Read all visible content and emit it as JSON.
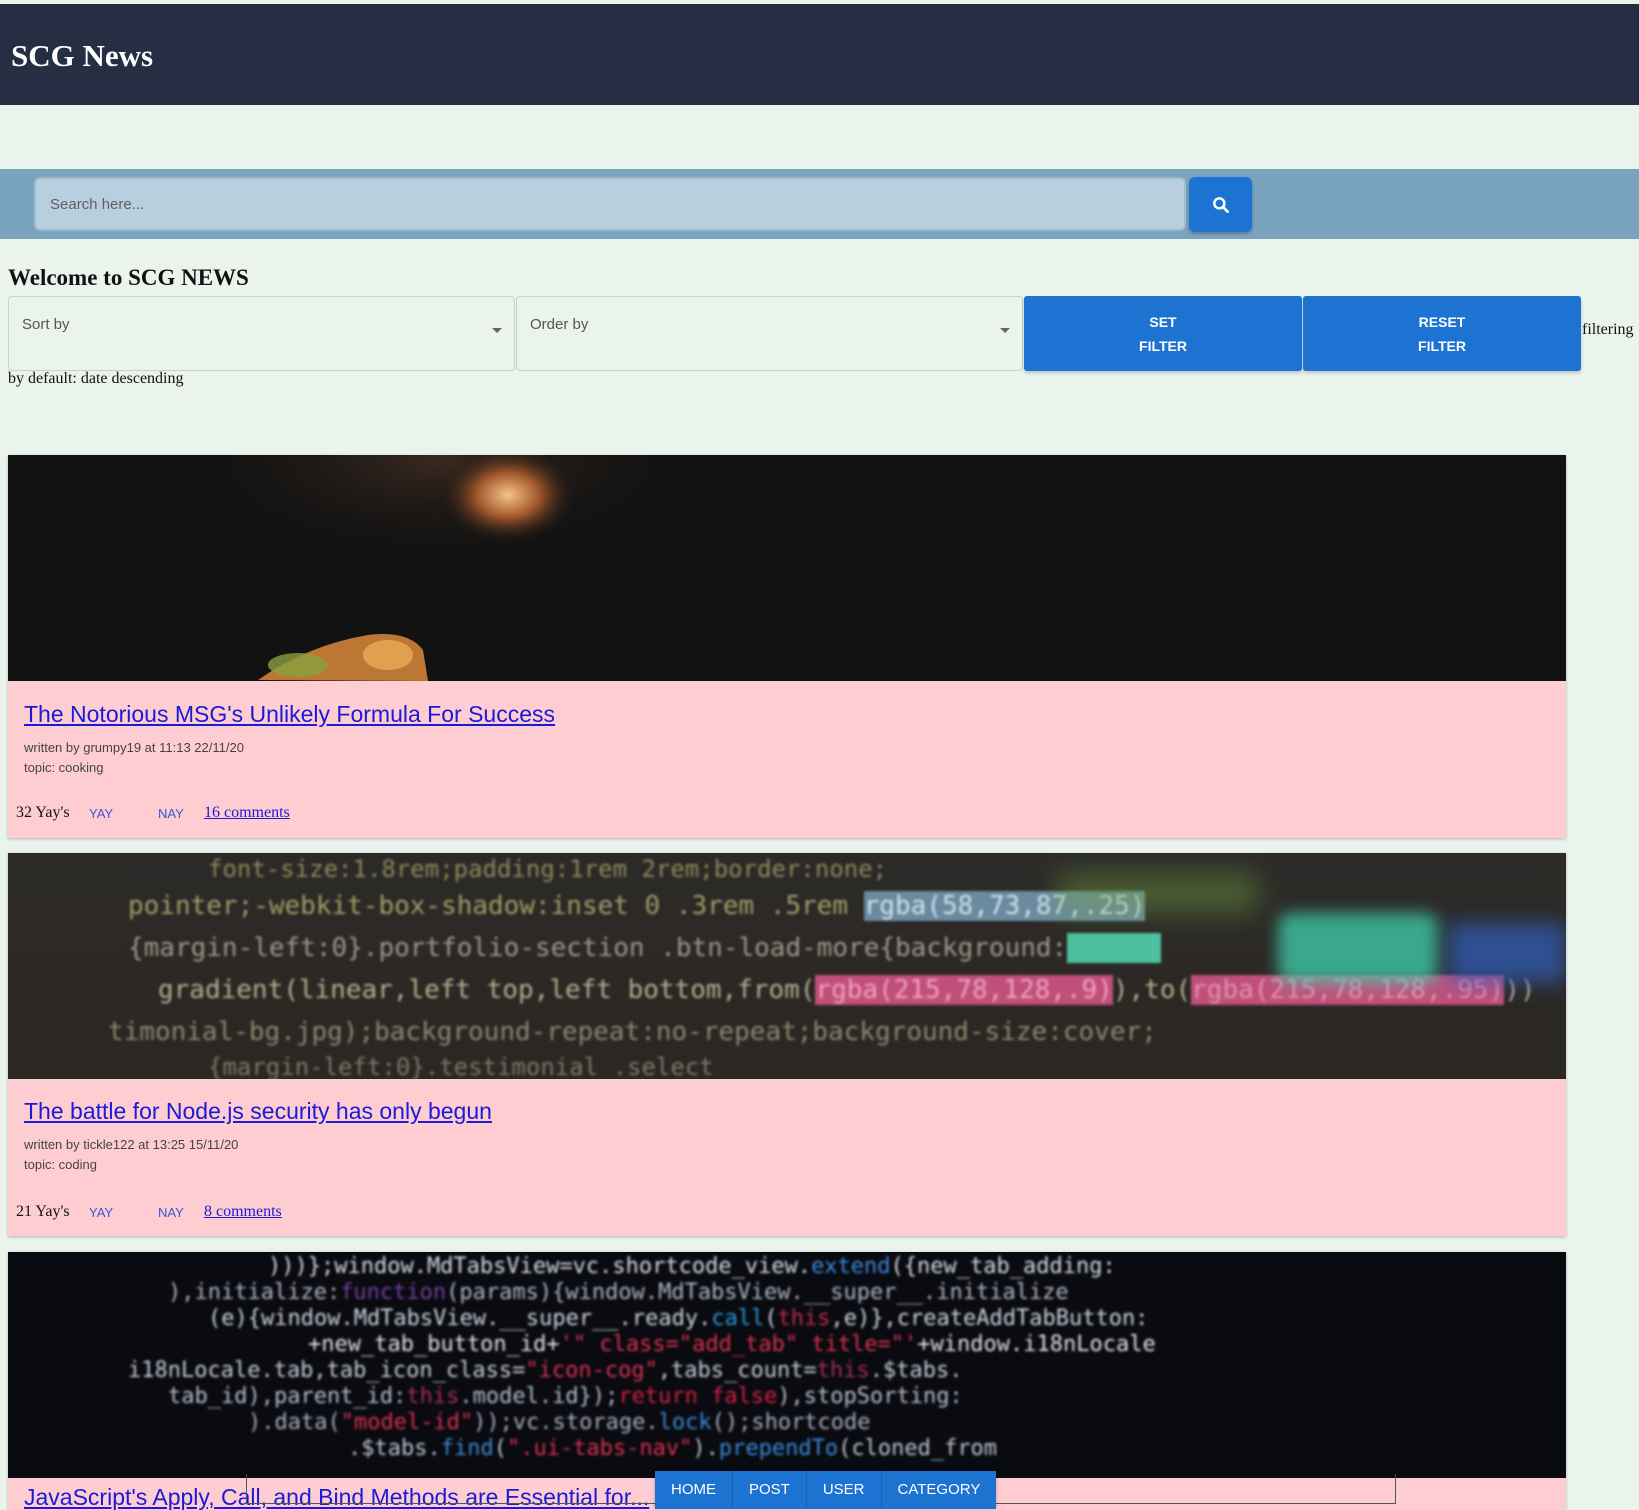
{
  "header": {
    "title": "SCG News"
  },
  "search": {
    "placeholder": "Search here...",
    "button_icon": "search-icon"
  },
  "welcome": "Welcome to SCG NEWS",
  "filters": {
    "sort_label": "Sort by",
    "order_label": "Order by",
    "set_filter": [
      "SET",
      "FILTER"
    ],
    "reset_filter": [
      "RESET",
      "FILTER"
    ],
    "filtering_text": "filtering",
    "default_note": "by default: date descending"
  },
  "posts": [
    {
      "title": "The Notorious MSG's Unlikely Formula For Success",
      "byline": "written by grumpy19 at 11:13 22/11/20",
      "topic": "topic: cooking",
      "yays": "32 Yay's",
      "yay_label": "YAY",
      "nay_label": "NAY",
      "comments": "16 comments"
    },
    {
      "title": "The battle for Node.js security has only begun",
      "byline": "written by tickle122 at 13:25 15/11/20",
      "topic": "topic: coding",
      "yays": "21 Yay's",
      "yay_label": "YAY",
      "nay_label": "NAY",
      "comments": "8 comments"
    },
    {
      "title": "JavaScript's Apply, Call, and Bind Methods are Essential for..."
    }
  ],
  "bottom_nav": [
    "HOME",
    "POST",
    "USER",
    "CATEGORY"
  ],
  "colors": {
    "header_bg": "#252e42",
    "accent": "#1c73d2",
    "card_bg": "#fecdd2",
    "page_bg": "#eaf3ec",
    "search_bar_bg": "#7aa3bf"
  }
}
